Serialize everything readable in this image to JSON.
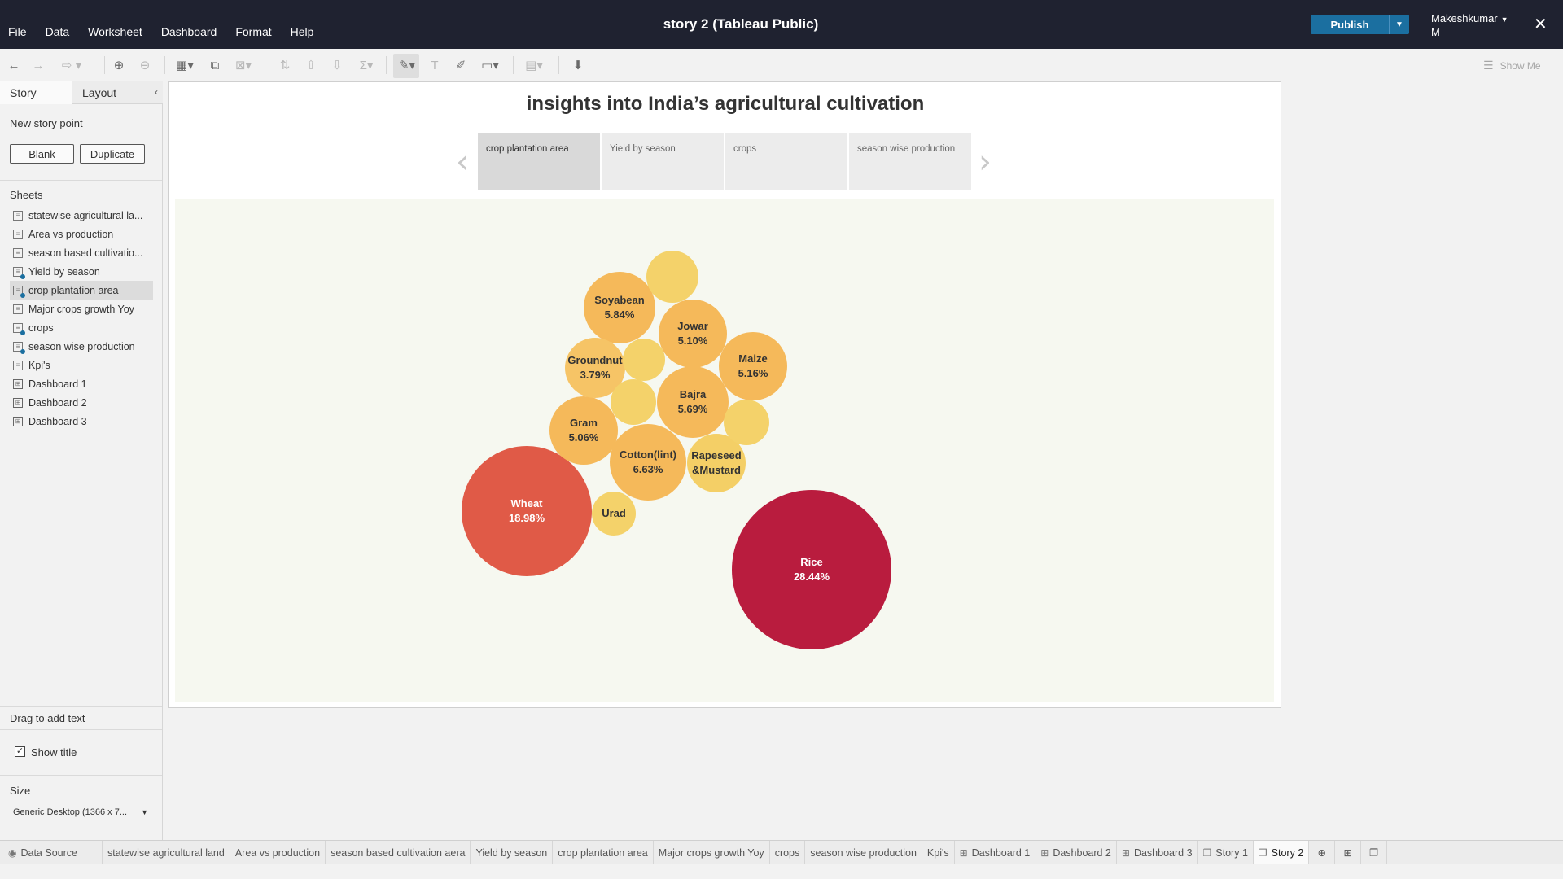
{
  "app": {
    "title": "story 2 (Tableau Public)",
    "menu": [
      "File",
      "Data",
      "Worksheet",
      "Dashboard",
      "Format",
      "Help"
    ],
    "publish_label": "Publish",
    "user_name": "Makeshkumar\nM",
    "user_line1": "Makeshkumar",
    "user_line2": "M",
    "show_me": "Show Me"
  },
  "left_panel": {
    "tab_story": "Story",
    "tab_layout": "Layout",
    "new_story_point": "New story point",
    "blank_label": "Blank",
    "duplicate_label": "Duplicate",
    "sheets_header": "Sheets",
    "sheets": [
      {
        "label": "statewise agricultural la...",
        "type": "sheet",
        "dot": false
      },
      {
        "label": "Area vs production",
        "type": "sheet",
        "dot": false
      },
      {
        "label": "season based cultivatio...",
        "type": "sheet",
        "dot": false
      },
      {
        "label": "Yield by season",
        "type": "sheet",
        "dot": true
      },
      {
        "label": "crop plantation area",
        "type": "sheet",
        "dot": true,
        "selected": true
      },
      {
        "label": "Major crops growth Yoy",
        "type": "sheet",
        "dot": false
      },
      {
        "label": "crops",
        "type": "sheet",
        "dot": true
      },
      {
        "label": "season wise production",
        "type": "sheet",
        "dot": true
      },
      {
        "label": "Kpi's",
        "type": "sheet",
        "dot": false
      },
      {
        "label": "Dashboard 1",
        "type": "dashboard",
        "dot": false
      },
      {
        "label": "Dashboard 2",
        "type": "dashboard",
        "dot": false
      },
      {
        "label": "Dashboard 3",
        "type": "dashboard",
        "dot": false
      }
    ],
    "drag_text": "Drag to add text",
    "show_title": "Show title",
    "size_header": "Size",
    "size_value": "Generic Desktop (1366 x 7..."
  },
  "story": {
    "title": "insights into India’s agricultural cultivation",
    "captions": [
      {
        "label": "crop plantation area",
        "active": true
      },
      {
        "label": "Yield by season",
        "active": false
      },
      {
        "label": "crops",
        "active": false
      },
      {
        "label": "season wise production",
        "active": false
      }
    ]
  },
  "chart_data": {
    "type": "bubble",
    "title": "",
    "series": [
      {
        "name": "Rice",
        "value": 28.44,
        "label": "28.44%",
        "color": "#b91c3e"
      },
      {
        "name": "Wheat",
        "value": 18.98,
        "label": "18.98%",
        "color": "#e05a47"
      },
      {
        "name": "Cotton(lint)",
        "value": 6.63,
        "label": "6.63%",
        "color": "#f5b95a"
      },
      {
        "name": "Soyabean",
        "value": 5.84,
        "label": "5.84%",
        "color": "#f5b95a"
      },
      {
        "name": "Bajra",
        "value": 5.69,
        "label": "5.69%",
        "color": "#f5b95a"
      },
      {
        "name": "Maize",
        "value": 5.16,
        "label": "5.16%",
        "color": "#f5b95a"
      },
      {
        "name": "Jowar",
        "value": 5.1,
        "label": "5.10%",
        "color": "#f5b95a"
      },
      {
        "name": "Gram",
        "value": 5.06,
        "label": "5.06%",
        "color": "#f5b95a"
      },
      {
        "name": "Groundnut",
        "value": 3.79,
        "label": "3.79%",
        "color": "#f6c466"
      },
      {
        "name": "Rapeseed &Mustard",
        "value": null,
        "label": "",
        "color": "#f4cf66"
      },
      {
        "name": "Urad",
        "value": null,
        "label": "",
        "color": "#f4d26a"
      },
      {
        "name": "",
        "value": null,
        "label": "",
        "color": "#f4d26a"
      },
      {
        "name": "",
        "value": null,
        "label": "",
        "color": "#f4d26a"
      },
      {
        "name": "",
        "value": null,
        "label": "",
        "color": "#f4d26a"
      },
      {
        "name": "",
        "value": null,
        "label": "",
        "color": "#f4d26a"
      }
    ]
  },
  "bottom_tabs": [
    {
      "label": "Data Source",
      "icon": "datasource-icon",
      "active": false
    },
    {
      "label": "statewise agricultural land",
      "icon": "",
      "active": false
    },
    {
      "label": "Area vs production",
      "icon": "",
      "active": false
    },
    {
      "label": "season based cultivation aera",
      "icon": "",
      "active": false
    },
    {
      "label": "Yield by season",
      "icon": "",
      "active": false
    },
    {
      "label": "crop plantation area",
      "icon": "",
      "active": false
    },
    {
      "label": "Major crops growth Yoy",
      "icon": "",
      "active": false
    },
    {
      "label": "crops",
      "icon": "",
      "active": false
    },
    {
      "label": "season wise production",
      "icon": "",
      "active": false
    },
    {
      "label": "Kpi's",
      "icon": "",
      "active": false
    },
    {
      "label": "Dashboard 1",
      "icon": "dashboard-icon",
      "active": false
    },
    {
      "label": "Dashboard 2",
      "icon": "dashboard-icon",
      "active": false
    },
    {
      "label": "Dashboard 3",
      "icon": "dashboard-icon",
      "active": false
    },
    {
      "label": "Story 1",
      "icon": "story-icon",
      "active": false
    },
    {
      "label": "Story 2",
      "icon": "story-icon",
      "active": true
    }
  ]
}
